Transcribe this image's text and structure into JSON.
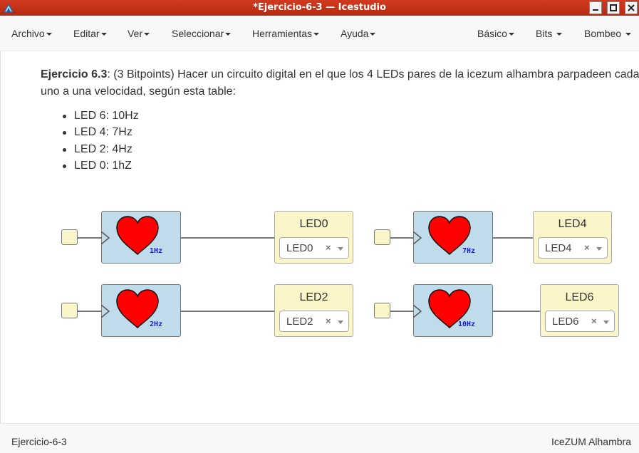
{
  "window": {
    "title": "*Ejercicio-6-3 — Icestudio"
  },
  "menubar": {
    "left": [
      "Archivo",
      "Editar",
      "Ver",
      "Seleccionar",
      "Herramientas",
      "Ayuda"
    ],
    "right": [
      "Básico",
      "Bits",
      "Bombeo"
    ]
  },
  "content": {
    "heading": "Ejercicio 6.3",
    "text_line1": ": (3 Bitpoints) Hacer un circuito digital en el que los 4 LEDs pares de la icezum alhambra parpadeen cada",
    "text_line2": "uno a una velocidad, según esta table:",
    "list": [
      "LED 6: 10Hz",
      "LED 4: 7Hz",
      "LED 2: 4Hz",
      "LED 0: 1hZ"
    ]
  },
  "circuit": {
    "heart_color": "#ff0000",
    "blocks": [
      {
        "freq": "1Hz",
        "led_title": "LED0",
        "led_value": "LED0"
      },
      {
        "freq": "7Hz",
        "led_title": "LED4",
        "led_value": "LED4"
      },
      {
        "freq": "2Hz",
        "led_title": "LED2",
        "led_value": "LED2"
      },
      {
        "freq": "10Hz",
        "led_title": "LED6",
        "led_value": "LED6"
      }
    ]
  },
  "footer": {
    "left": "Ejercicio-6-3",
    "right": "IceZUM Alhambra"
  }
}
